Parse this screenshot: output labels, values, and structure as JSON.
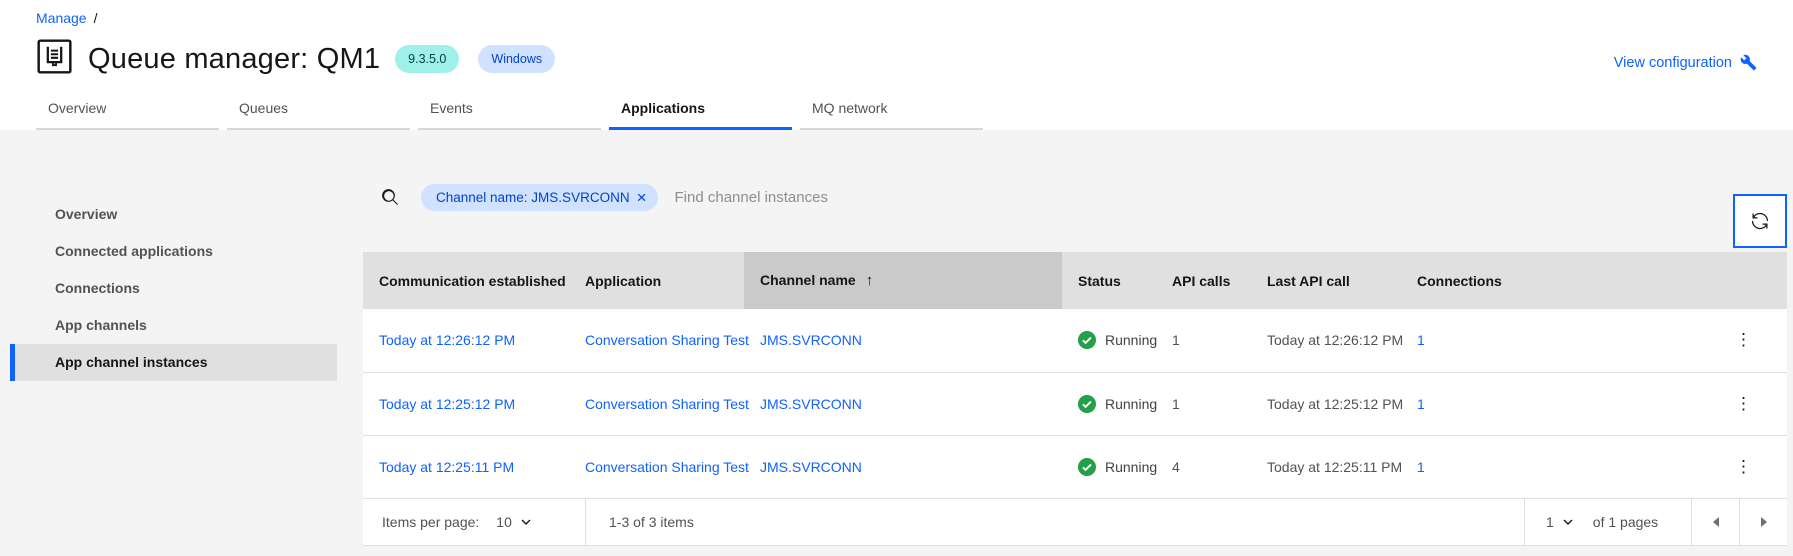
{
  "breadcrumb": {
    "manage_label": "Manage",
    "separator": "/"
  },
  "header": {
    "title": "Queue manager: QM1",
    "version_badge": "9.3.5.0",
    "platform_badge": "Windows",
    "view_configuration_label": "View configuration"
  },
  "tabs": [
    {
      "label": "Overview",
      "selected": false
    },
    {
      "label": "Queues",
      "selected": false
    },
    {
      "label": "Events",
      "selected": false
    },
    {
      "label": "Applications",
      "selected": true
    },
    {
      "label": "MQ network",
      "selected": false
    }
  ],
  "sidebar": {
    "items": [
      {
        "label": "Overview",
        "selected": false
      },
      {
        "label": "Connected applications",
        "selected": false
      },
      {
        "label": "Connections",
        "selected": false
      },
      {
        "label": "App channels",
        "selected": false
      },
      {
        "label": "App channel instances",
        "selected": true
      }
    ]
  },
  "toolbar": {
    "filter_tag_label": "Channel name: JMS.SVRCONN",
    "search_placeholder": "Find channel instances"
  },
  "table": {
    "columns": [
      "Communication established",
      "Application",
      "Channel name",
      "Status",
      "API calls",
      "Last API call",
      "Connections"
    ],
    "sorted_column": "Channel name",
    "sort_direction": "ascending",
    "rows": [
      {
        "communication_established": "Today at 12:26:12 PM",
        "application": "Conversation Sharing Test",
        "channel_name": "JMS.SVRCONN",
        "status": "Running",
        "api_calls": "1",
        "last_api_call": "Today at 12:26:12 PM",
        "connections": "1"
      },
      {
        "communication_established": "Today at 12:25:12 PM",
        "application": "Conversation Sharing Test",
        "channel_name": "JMS.SVRCONN",
        "status": "Running",
        "api_calls": "1",
        "last_api_call": "Today at 12:25:12 PM",
        "connections": "1"
      },
      {
        "communication_established": "Today at 12:25:11 PM",
        "application": "Conversation Sharing Test",
        "channel_name": "JMS.SVRCONN",
        "status": "Running",
        "api_calls": "4",
        "last_api_call": "Today at 12:25:11 PM",
        "connections": "1"
      }
    ]
  },
  "pagination": {
    "items_per_page_label": "Items per page:",
    "items_per_page_value": "10",
    "range_text": "1-3 of 3 items",
    "page_value": "1",
    "pages_text": "of 1 pages"
  },
  "icons": {
    "sort_ascending": "↑",
    "overflow_menu": "⋮",
    "tag_close": "×"
  },
  "colors": {
    "accent_blue": "#0f62fe",
    "link_blue": "#0f62fe",
    "tag_blue_bg": "#d0e2ff",
    "tag_blue_text": "#0043ce",
    "badge_teal_bg": "#9ef0e8",
    "badge_teal_text": "#004144",
    "status_green": "#24a148",
    "content_bg": "#f4f4f4",
    "table_header_bg": "#e0e0e0",
    "sorted_header_bg": "#cacaca"
  }
}
